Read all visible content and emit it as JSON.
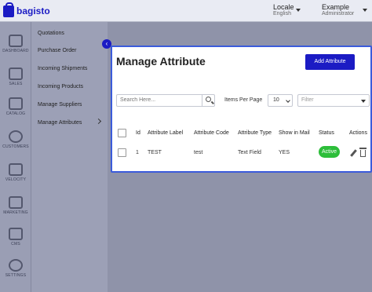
{
  "app": {
    "brand": "bagisto"
  },
  "header": {
    "locale_label": "Locale",
    "locale_value": "English",
    "user_name": "Example",
    "user_role": "Administrator"
  },
  "nav": [
    {
      "label": "DASHBOARD",
      "icon": "dashboard-icon"
    },
    {
      "label": "SALES",
      "icon": "sales-icon"
    },
    {
      "label": "CATALOG",
      "icon": "catalog-icon"
    },
    {
      "label": "CUSTOMERS",
      "icon": "customers-icon"
    },
    {
      "label": "VELOCITY",
      "icon": "velocity-icon"
    },
    {
      "label": "MARKETING",
      "icon": "marketing-icon"
    },
    {
      "label": "CMS",
      "icon": "cms-icon"
    },
    {
      "label": "SETTINGS",
      "icon": "settings-icon"
    }
  ],
  "submenu": [
    "Quotations",
    "Purchase Order",
    "Incoming Shipments",
    "Incoming Products",
    "Manage Suppliers",
    "Manage Attributes"
  ],
  "page": {
    "title": "Manage Attribute",
    "add_button": "Add Attribute",
    "search_placeholder": "Search Here...",
    "items_per_page_label": "Items Per Page",
    "items_per_page_value": "10",
    "filter_placeholder": "Filter"
  },
  "table": {
    "headers": [
      "Id",
      "Attribute Label",
      "Attribute Code",
      "Attribute Type",
      "Show in Mail",
      "Status",
      "Actions"
    ],
    "rows": [
      {
        "id": "1",
        "label": "TEST",
        "code": "test",
        "type": "Text Field",
        "show_in_mail": "YES",
        "status": "Active"
      }
    ]
  },
  "colors": {
    "accent": "#1b1bc4",
    "active": "#2dbe3a"
  }
}
